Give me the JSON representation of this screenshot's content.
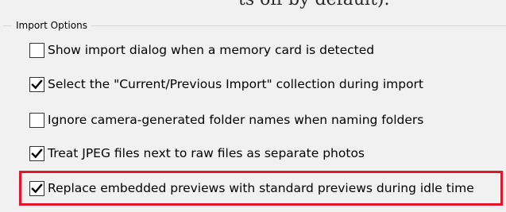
{
  "page": {
    "top_caption": "ts off by default)."
  },
  "group": {
    "legend": "Import Options"
  },
  "options": [
    {
      "label": "Show import dialog when a memory card is detected",
      "checked": false
    },
    {
      "label": "Select the \"Current/Previous Import\" collection during import",
      "checked": true
    },
    {
      "label": "Ignore camera-generated folder names when naming folders",
      "checked": false
    },
    {
      "label": "Treat JPEG files next to raw files as separate photos",
      "checked": true
    },
    {
      "label": "Replace embedded previews with standard previews during idle time",
      "checked": true
    }
  ],
  "colors": {
    "panel_background": "#f1f1f1",
    "checkbox_border": "#333333",
    "highlight": "#e0162b"
  },
  "icons": {
    "checked": "check-mark-icon"
  }
}
